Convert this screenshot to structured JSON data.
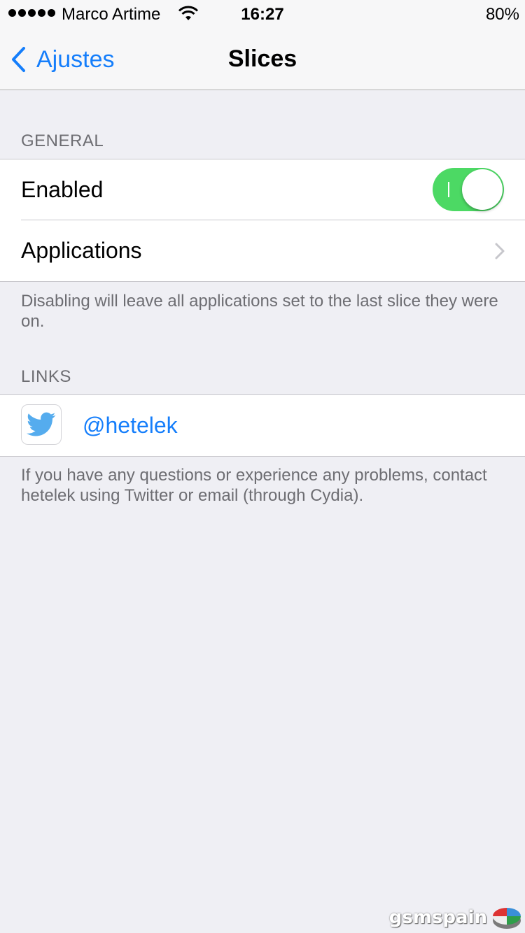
{
  "status_bar": {
    "carrier": "Marco Artime",
    "time": "16:27",
    "battery": "80%"
  },
  "nav": {
    "back_label": "Ajustes",
    "title": "Slices"
  },
  "general": {
    "header": "GENERAL",
    "enabled_label": "Enabled",
    "enabled_on": true,
    "applications_label": "Applications",
    "footer": "Disabling will leave all applications set to the last slice they were on."
  },
  "links": {
    "header": "LINKS",
    "twitter_handle": "@hetelek",
    "footer": "If you have any questions or experience any problems, contact hetelek using Twitter or email (through Cydia)."
  },
  "watermark": {
    "text": "gsmspain"
  },
  "colors": {
    "accent": "#157efb",
    "toggle_on": "#4cd964",
    "background": "#efeff4",
    "twitter": "#55acee"
  },
  "icons": {
    "back": "chevron-left-icon",
    "disclosure": "chevron-right-icon",
    "twitter": "twitter-bird-icon",
    "wifi": "wifi-icon"
  }
}
